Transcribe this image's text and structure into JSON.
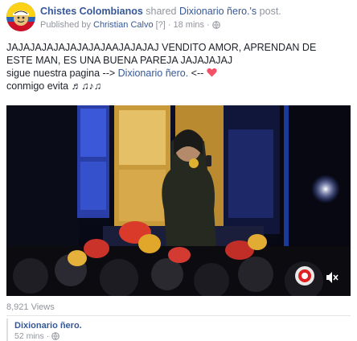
{
  "header": {
    "page_name": "Chistes Colombianos",
    "shared_text": "shared",
    "shared_target": "Dixionario ñero.'s",
    "post_word": "post.",
    "published_by": "Published by",
    "publisher": "Christian Calvo",
    "help_mark": "[?]",
    "separator": "·",
    "time": "18 mins",
    "time_sep": "·"
  },
  "post": {
    "line1": "JAJAJAJAJAJAJAJAJAAJAJAJAJ VENDITO AMOR, APRENDAN DE",
    "line2": "ESTE MAN, ES UNA BUENA PAREJA JAJAJAJAJ",
    "line3_prefix": "sigue nuestra pagina --> ",
    "line3_link": "Dixionario ñero.",
    "line3_suffix": " <-- ",
    "line4": "conmigo evita ♬♫♪♫"
  },
  "video": {
    "icons": [
      "volume-mute-icon",
      "channel-logo-icon"
    ]
  },
  "stats": {
    "views": "8,921 Views"
  },
  "original": {
    "name": "Dixionario ñero.",
    "time": "52 mins",
    "separator": "·"
  },
  "colors": {
    "link": "#365899",
    "muted": "#90949c",
    "heart": "#f25268"
  }
}
